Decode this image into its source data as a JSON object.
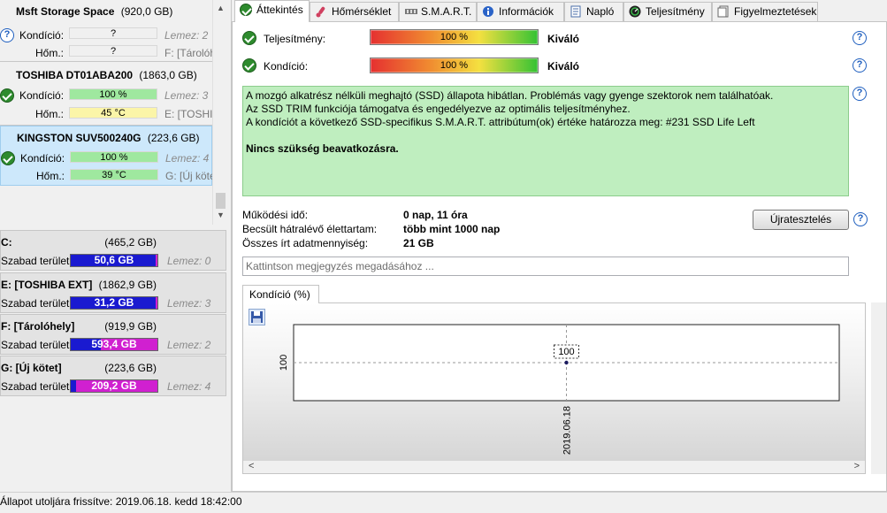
{
  "left_panel": {
    "disks": [
      {
        "name": "Msft     Storage Space",
        "size": "(920,0 GB)",
        "kondicio_label": "Kondíció:",
        "kondicio_value": "?",
        "kondicio_status": "question-icon",
        "lemez": "Lemez: 2",
        "hom_label": "Hőm.:",
        "hom_value": "?",
        "partitions": "F: [Tárolóh"
      },
      {
        "name": "TOSHIBA DT01ABA200",
        "size": "(1863,0 GB)",
        "kondicio_label": "Kondíció:",
        "kondicio_value": "100 %",
        "kondicio_status": "ok-icon",
        "lemez": "Lemez: 3",
        "hom_label": "Hőm.:",
        "hom_value": "45 °C",
        "partitions": "E: [TOSHIB"
      },
      {
        "name": "KINGSTON SUV500240G",
        "size": "(223,6 GB)",
        "kondicio_label": "Kondíció:",
        "kondicio_value": "100 %",
        "kondicio_status": "ok-icon",
        "lemez": "Lemez: 4",
        "hom_label": "Hőm.:",
        "hom_value": "39 °C",
        "partitions": "G: [Új köte"
      }
    ],
    "volumes": [
      {
        "name": "C:",
        "size": "(465,2 GB)",
        "free_label": "Szabad terület",
        "free_value": "50,6 GB",
        "free_fraction": 0.11,
        "lemez": "Lemez: 0"
      },
      {
        "name": "E: [TOSHIBA EXT]",
        "size": "(1862,9 GB)",
        "free_label": "Szabad terület",
        "free_value": "31,2 GB",
        "free_fraction": 0.02,
        "lemez": "Lemez: 3"
      },
      {
        "name": "F: [Tárolóhely]",
        "size": "(919,9 GB)",
        "free_label": "Szabad terület",
        "free_value": "593,4 GB",
        "free_fraction": 0.65,
        "lemez": "Lemez: 2"
      },
      {
        "name": "G: [Új kötet]",
        "size": "(223,6 GB)",
        "free_label": "Szabad terület",
        "free_value": "209,2 GB",
        "free_fraction": 0.94,
        "lemez": "Lemez: 4"
      }
    ]
  },
  "tabs": [
    {
      "label": "Áttekintés",
      "icon": "ok-icon",
      "active": true
    },
    {
      "label": "Hőmérséklet",
      "icon": "thermometer-icon",
      "active": false
    },
    {
      "label": "S.M.A.R.T.",
      "icon": "smart-icon",
      "active": false
    },
    {
      "label": "Információk",
      "icon": "info-icon",
      "active": false
    },
    {
      "label": "Napló",
      "icon": "log-icon",
      "active": false
    },
    {
      "label": "Teljesítmény",
      "icon": "gauge-icon",
      "active": false
    },
    {
      "label": "Figyelmeztetések",
      "icon": "alert-icon",
      "active": false
    }
  ],
  "overview": {
    "performance_label": "Teljesítmény:",
    "performance_value": "100 %",
    "performance_rating": "Kiváló",
    "condition_label": "Kondíció:",
    "condition_value": "100 %",
    "condition_rating": "Kiváló",
    "info_lines": [
      "A mozgó alkatrész nélküli meghajtó (SSD) állapota hibátlan. Problémás vagy gyenge szektorok nem találhatóak.",
      "Az SSD TRIM funkciója támogatva és engedélyezve az optimális teljesítményhez.",
      "A kondíciót a következő SSD-specifikus S.M.A.R.T. attribútum(ok) értéke határozza meg:  #231 SSD Life Left"
    ],
    "info_bold": "Nincs szükség beavatkozásra.",
    "uptime_label": "Működési idő:",
    "uptime_value": "0 nap, 11 óra",
    "lifetime_label": "Becsült hátralévő élettartam:",
    "lifetime_value": "több mint 1000 nap",
    "written_label": "Összes írt adatmennyiség:",
    "written_value": "21 GB",
    "retest_button": "Újratesztelés",
    "note_placeholder": "Kattintson megjegyzés megadásához ..."
  },
  "chart_tab": "Kondíció  (%)",
  "chart_data": {
    "type": "line",
    "title": "",
    "xlabel": "",
    "ylabel": "",
    "x": [
      "2019.06.18"
    ],
    "series": [
      {
        "values": [
          100
        ]
      }
    ],
    "y_tick": "100",
    "point_label": "100"
  },
  "status_bar": {
    "text": "Állapot utoljára frissítve: 2019.06.18. kedd 18:42:00"
  },
  "colors": {
    "ok_green": "#2e8b2e",
    "info_bg": "#bfeebf",
    "free_blue": "#1a1ad0",
    "used_magenta": "#d020d0"
  }
}
